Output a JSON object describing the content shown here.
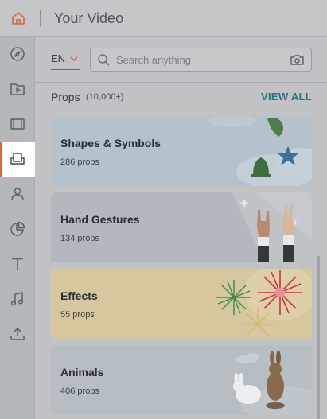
{
  "header": {
    "title": "Your Video"
  },
  "sidebar": {
    "items": [
      {
        "icon": "compass-icon"
      },
      {
        "icon": "video-folder-icon"
      },
      {
        "icon": "film-icon"
      },
      {
        "icon": "armchair-icon",
        "active": true
      },
      {
        "icon": "person-icon"
      },
      {
        "icon": "pie-chart-icon"
      },
      {
        "icon": "text-icon"
      },
      {
        "icon": "music-note-icon"
      },
      {
        "icon": "upload-icon"
      }
    ]
  },
  "search": {
    "language": "EN",
    "placeholder": "Search anything"
  },
  "section": {
    "title": "Props",
    "count": "(10,000+)",
    "view_all": "VIEW ALL"
  },
  "cards": [
    {
      "name": "Shapes & Symbols",
      "count": "286 props",
      "bg": "#b6c2cb"
    },
    {
      "name": "Hand Gestures",
      "count": "134 props",
      "bg": "#b3b8be"
    },
    {
      "name": "Effects",
      "count": "55 props",
      "bg": "#d6c79f"
    },
    {
      "name": "Animals",
      "count": "406 props",
      "bg": "#b6bec4"
    }
  ],
  "colors": {
    "accent": "#e0673a",
    "link": "#1d7585"
  }
}
